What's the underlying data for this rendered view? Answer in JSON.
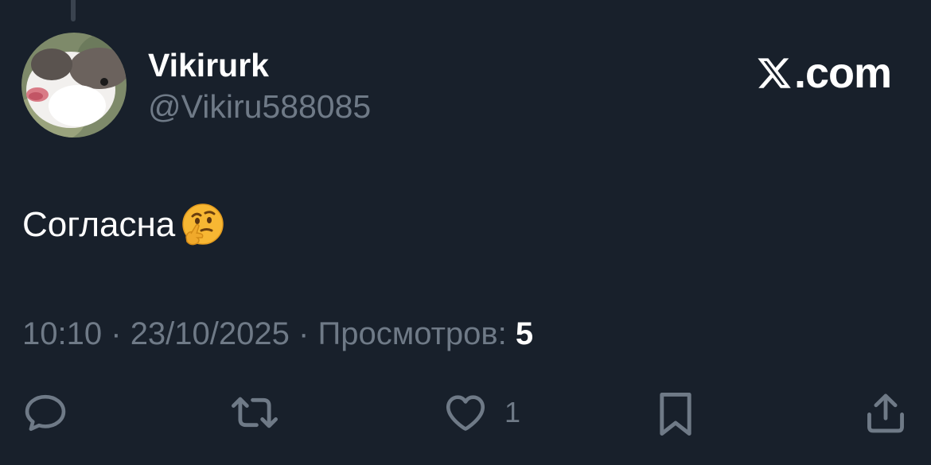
{
  "colors": {
    "background": "#18202b",
    "primary_text": "#ffffff",
    "secondary_text": "#6f7a87"
  },
  "author": {
    "display_name": "Vikirurk",
    "handle": "@Vikiru588085",
    "avatar": "avatar-photo"
  },
  "brand": {
    "logo_icon": "x-logo-icon",
    "domain_text": ".com"
  },
  "post": {
    "text": "Согласна",
    "emoji": "thinking-face-emoji"
  },
  "meta": {
    "time": "10:10",
    "separator": "·",
    "date": "23/10/2025",
    "views_label": "Просмотров:",
    "views_count": "5"
  },
  "actions": {
    "reply": {
      "icon": "reply-icon",
      "count": ""
    },
    "repost": {
      "icon": "repost-icon",
      "count": ""
    },
    "like": {
      "icon": "heart-icon",
      "count": "1"
    },
    "bookmark": {
      "icon": "bookmark-icon",
      "count": ""
    },
    "share": {
      "icon": "share-icon",
      "count": ""
    }
  }
}
